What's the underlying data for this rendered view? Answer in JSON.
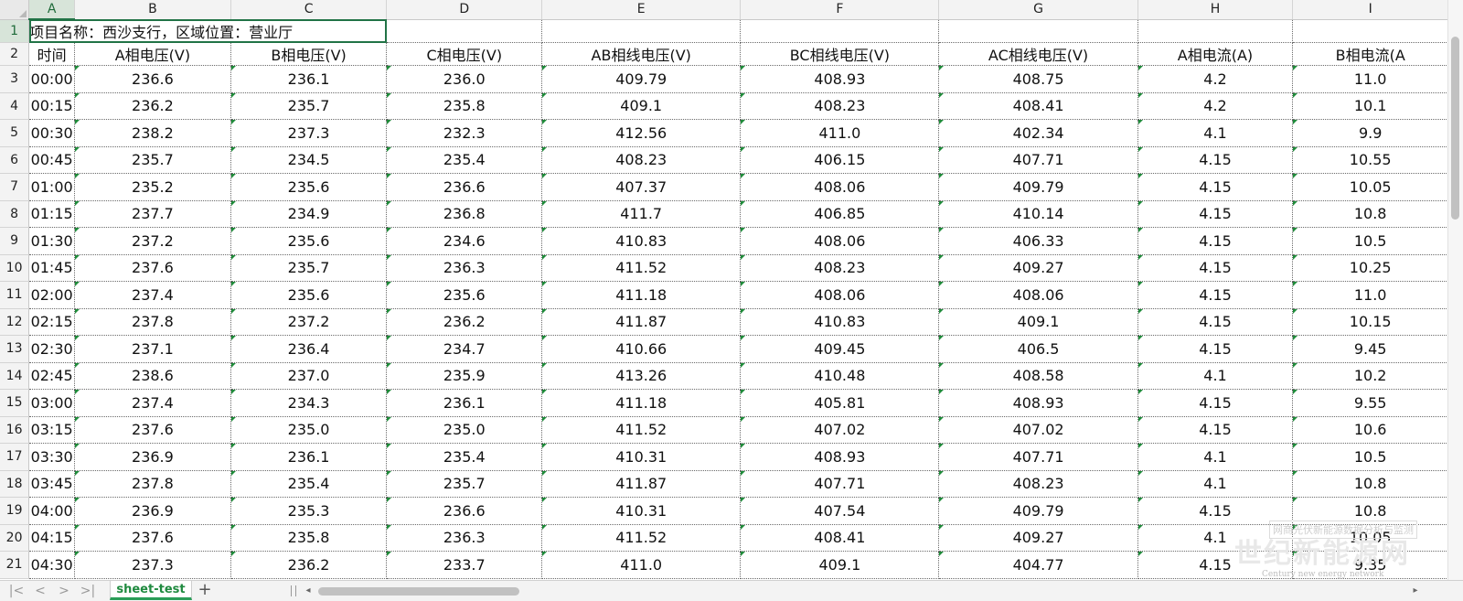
{
  "sheet": {
    "active_cell": "A1",
    "columns": [
      "A",
      "B",
      "C",
      "D",
      "E",
      "F",
      "G",
      "H",
      "I"
    ],
    "title_row": {
      "row": "1",
      "text": "项目名称：西沙支行，区域位置：营业厅"
    },
    "header_row": {
      "row": "2",
      "cells": [
        "时间",
        "A相电压(V)",
        "B相电压(V)",
        "C相电压(V)",
        "AB相线电压(V)",
        "BC相线电压(V)",
        "AC相线电压(V)",
        "A相电流(A)",
        "B相电流(A"
      ]
    },
    "rows": [
      {
        "n": "3",
        "cells": [
          "00:00",
          "236.6",
          "236.1",
          "236.0",
          "409.79",
          "408.93",
          "408.75",
          "4.2",
          "11.0"
        ]
      },
      {
        "n": "4",
        "cells": [
          "00:15",
          "236.2",
          "235.7",
          "235.8",
          "409.1",
          "408.23",
          "408.41",
          "4.2",
          "10.1"
        ]
      },
      {
        "n": "5",
        "cells": [
          "00:30",
          "238.2",
          "237.3",
          "232.3",
          "412.56",
          "411.0",
          "402.34",
          "4.1",
          "9.9"
        ]
      },
      {
        "n": "6",
        "cells": [
          "00:45",
          "235.7",
          "234.5",
          "235.4",
          "408.23",
          "406.15",
          "407.71",
          "4.15",
          "10.55"
        ]
      },
      {
        "n": "7",
        "cells": [
          "01:00",
          "235.2",
          "235.6",
          "236.6",
          "407.37",
          "408.06",
          "409.79",
          "4.15",
          "10.05"
        ]
      },
      {
        "n": "8",
        "cells": [
          "01:15",
          "237.7",
          "234.9",
          "236.8",
          "411.7",
          "406.85",
          "410.14",
          "4.15",
          "10.8"
        ]
      },
      {
        "n": "9",
        "cells": [
          "01:30",
          "237.2",
          "235.6",
          "234.6",
          "410.83",
          "408.06",
          "406.33",
          "4.15",
          "10.5"
        ]
      },
      {
        "n": "10",
        "cells": [
          "01:45",
          "237.6",
          "235.7",
          "236.3",
          "411.52",
          "408.23",
          "409.27",
          "4.15",
          "10.25"
        ]
      },
      {
        "n": "11",
        "cells": [
          "02:00",
          "237.4",
          "235.6",
          "235.6",
          "411.18",
          "408.06",
          "408.06",
          "4.15",
          "11.0"
        ]
      },
      {
        "n": "12",
        "cells": [
          "02:15",
          "237.8",
          "237.2",
          "236.2",
          "411.87",
          "410.83",
          "409.1",
          "4.15",
          "10.15"
        ]
      },
      {
        "n": "13",
        "cells": [
          "02:30",
          "237.1",
          "236.4",
          "234.7",
          "410.66",
          "409.45",
          "406.5",
          "4.15",
          "9.45"
        ]
      },
      {
        "n": "14",
        "cells": [
          "02:45",
          "238.6",
          "237.0",
          "235.9",
          "413.26",
          "410.48",
          "408.58",
          "4.1",
          "10.2"
        ]
      },
      {
        "n": "15",
        "cells": [
          "03:00",
          "237.4",
          "234.3",
          "236.1",
          "411.18",
          "405.81",
          "408.93",
          "4.15",
          "9.55"
        ]
      },
      {
        "n": "16",
        "cells": [
          "03:15",
          "237.6",
          "235.0",
          "235.0",
          "411.52",
          "407.02",
          "407.02",
          "4.15",
          "10.6"
        ]
      },
      {
        "n": "17",
        "cells": [
          "03:30",
          "236.9",
          "236.1",
          "235.4",
          "410.31",
          "408.93",
          "407.71",
          "4.1",
          "10.5"
        ]
      },
      {
        "n": "18",
        "cells": [
          "03:45",
          "237.8",
          "235.4",
          "235.7",
          "411.87",
          "407.71",
          "408.23",
          "4.1",
          "10.8"
        ]
      },
      {
        "n": "19",
        "cells": [
          "04:00",
          "236.9",
          "235.3",
          "236.6",
          "410.31",
          "407.54",
          "409.79",
          "4.15",
          "10.8"
        ]
      },
      {
        "n": "20",
        "cells": [
          "04:15",
          "237.6",
          "235.8",
          "236.3",
          "411.52",
          "408.41",
          "409.27",
          "4.1",
          "10.05"
        ]
      },
      {
        "n": "21",
        "cells": [
          "04:30",
          "237.3",
          "236.2",
          "233.7",
          "411.0",
          "409.1",
          "404.77",
          "4.15",
          "9.35"
        ]
      }
    ]
  },
  "tabs": {
    "sheet_name": "sheet-test",
    "add_label": "+",
    "nav": {
      "first": "|<",
      "prev": "<",
      "next": ">",
      "last": ">|"
    }
  },
  "scroll": {
    "left_arrow": "◂",
    "right_arrow": "▸"
  },
  "watermark": {
    "top": "网商光伏新能源数据分析与监测",
    "big": "世纪新能源网",
    "en": "Century new energy network"
  },
  "colors": {
    "accent": "#217346",
    "tab_text": "#1f8a3f",
    "grid_line": "#6a6a6a"
  },
  "icons": {
    "corner": "select-all-triangle",
    "comment_marker": "green-corner-triangle"
  }
}
